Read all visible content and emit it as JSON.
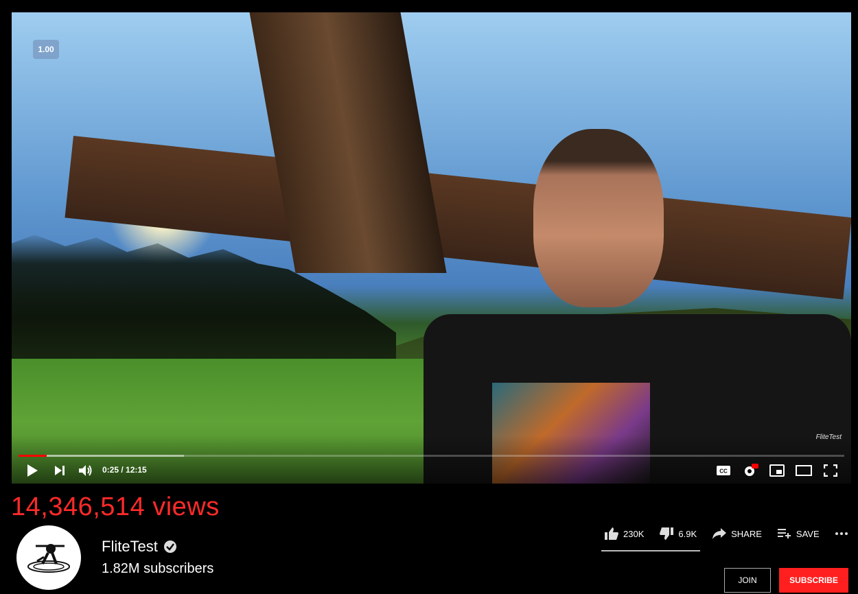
{
  "player": {
    "speed_badge": "1.00",
    "time_display": "0:25 / 12:15",
    "progress_fraction": 0.034,
    "buffer_fraction": 0.2,
    "watermark": "FliteTest",
    "icons": [
      "play-icon",
      "next-icon",
      "volume-icon",
      "captions-icon",
      "settings-icon",
      "miniplayer-icon",
      "theater-icon",
      "fullscreen-icon"
    ]
  },
  "video": {
    "views": "14,346,514 views"
  },
  "channel": {
    "name": "FliteTest",
    "subscribers": "1.82M subscribers"
  },
  "actions": {
    "likes": "230K",
    "dislikes": "6.9K",
    "share_label": "SHARE",
    "save_label": "SAVE",
    "join_label": "JOIN",
    "subscribe_label": "SUBSCRIBE"
  },
  "colors": {
    "views_red": "#ff2a2a",
    "subscribe_red": "#ff1f1f",
    "progress_red": "#ff0000"
  }
}
